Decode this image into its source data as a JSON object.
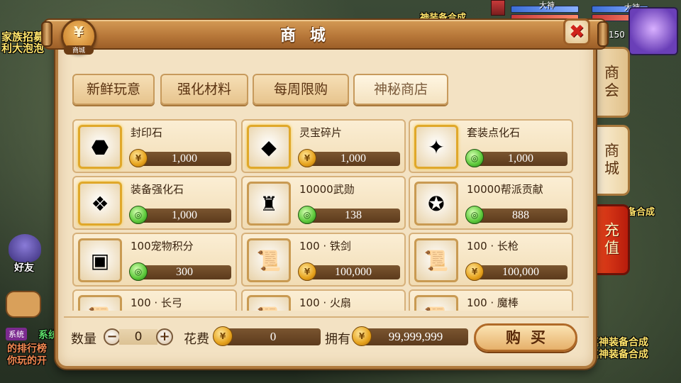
{
  "background": {
    "left_text_1": "家族招募",
    "left_text_2": "利大泡泡",
    "friend_label": "好友",
    "system_badge": "系统",
    "chat_line_1": "系统",
    "chat_line_2": "的排行榜",
    "chat_line_3": "你玩的开",
    "right_text_1": "备合成",
    "right_text_2": "真神装备合成",
    "right_text_3": "真神装备合成",
    "top_text": "神装备合成",
    "hud_name_1": "大神",
    "hud_name_2": "大神",
    "hud_level": "150"
  },
  "shop": {
    "title": "商 城",
    "logo_label": "商城",
    "logo_glyph": "¥",
    "close_icon": "✖",
    "colors": {
      "accent": "#b07a3e",
      "panel": "#f3e2c3",
      "recharge": "#d8300e"
    }
  },
  "tabs": [
    {
      "label": "新鲜玩意",
      "active": false
    },
    {
      "label": "强化材料",
      "active": false
    },
    {
      "label": "每周限购",
      "active": false
    },
    {
      "label": "神秘商店",
      "active": true
    }
  ],
  "side_tabs": {
    "guild": "商会",
    "shop": "商城",
    "recharge": "充值"
  },
  "items": [
    {
      "name": "封印石",
      "price": "1,000",
      "currency": "coin",
      "icon": "seal-stone-icon",
      "glyph": "⬣"
    },
    {
      "name": "灵宝碎片",
      "price": "1,000",
      "currency": "coin",
      "icon": "spirit-fragment-icon",
      "glyph": "◆"
    },
    {
      "name": "套装点化石",
      "price": "1,000",
      "currency": "jade",
      "icon": "set-stone-icon",
      "glyph": "✦"
    },
    {
      "name": "装备强化石",
      "price": "1,000",
      "currency": "jade",
      "icon": "enhance-stone-icon",
      "glyph": "❖"
    },
    {
      "name": "10000武勋",
      "price": "138",
      "currency": "jade",
      "icon": "merit-token-icon",
      "glyph": "♜"
    },
    {
      "name": "10000帮派贡献",
      "price": "888",
      "currency": "jade",
      "icon": "guild-badge-icon",
      "glyph": "✪"
    },
    {
      "name": "100宠物积分",
      "price": "300",
      "currency": "jade",
      "icon": "pet-points-icon",
      "glyph": "▣"
    },
    {
      "name": "100 · 铁剑",
      "price": "100,000",
      "currency": "coin",
      "icon": "scroll-icon",
      "glyph": "📜"
    },
    {
      "name": "100 · 长枪",
      "price": "100,000",
      "currency": "coin",
      "icon": "scroll-icon",
      "glyph": "📜"
    },
    {
      "name": "100 · 长弓",
      "price": "",
      "currency": "coin",
      "icon": "scroll-icon",
      "glyph": "📜"
    },
    {
      "name": "100 · 火扇",
      "price": "",
      "currency": "coin",
      "icon": "scroll-icon",
      "glyph": "📜"
    },
    {
      "name": "100 · 魔棒",
      "price": "",
      "currency": "coin",
      "icon": "scroll-icon",
      "glyph": "📜"
    }
  ],
  "purchase": {
    "qty_label": "数量",
    "qty_value": "0",
    "minus": "−",
    "plus": "+",
    "cost_label": "花费",
    "cost_value": "0",
    "owned_label": "拥有",
    "owned_value": "99,999,999",
    "buy_label": "购买"
  }
}
